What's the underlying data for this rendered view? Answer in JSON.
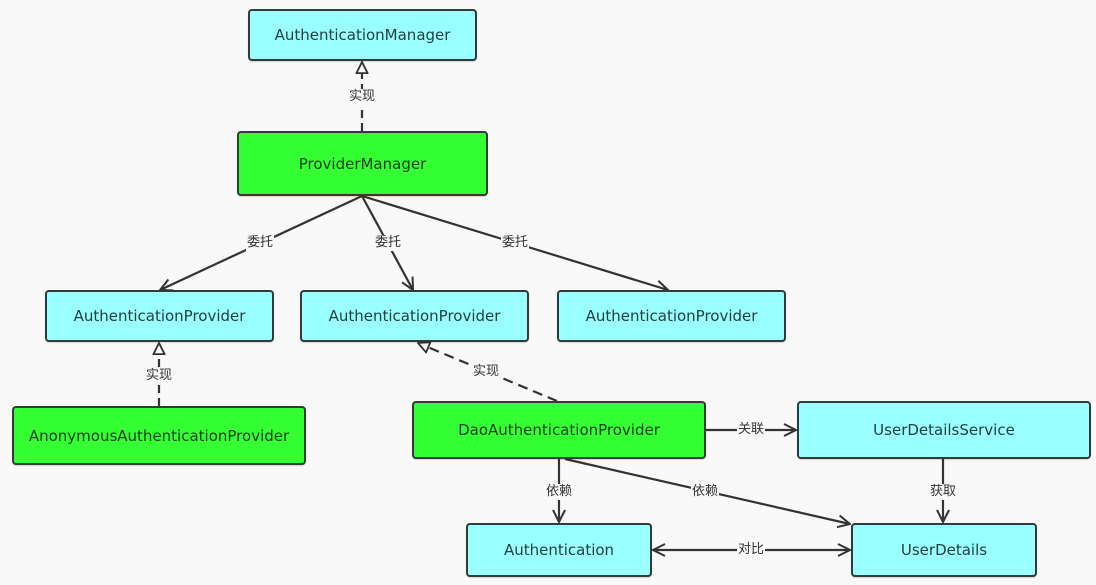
{
  "diagram": {
    "nodes": {
      "authentication_manager": {
        "label": "AuthenticationManager",
        "kind": "interface",
        "color": "#99ffff"
      },
      "provider_manager": {
        "label": "ProviderManager",
        "kind": "class",
        "color": "#33ff33"
      },
      "auth_provider_1": {
        "label": "AuthenticationProvider",
        "kind": "interface",
        "color": "#99ffff"
      },
      "auth_provider_2": {
        "label": "AuthenticationProvider",
        "kind": "interface",
        "color": "#99ffff"
      },
      "auth_provider_3": {
        "label": "AuthenticationProvider",
        "kind": "interface",
        "color": "#99ffff"
      },
      "anonymous_provider": {
        "label": "AnonymousAuthenticationProvider",
        "kind": "class",
        "color": "#33ff33"
      },
      "dao_provider": {
        "label": "DaoAuthenticationProvider",
        "kind": "class",
        "color": "#33ff33"
      },
      "user_details_service": {
        "label": "UserDetailsService",
        "kind": "interface",
        "color": "#99ffff"
      },
      "authentication": {
        "label": "Authentication",
        "kind": "interface",
        "color": "#99ffff"
      },
      "user_details": {
        "label": "UserDetails",
        "kind": "interface",
        "color": "#99ffff"
      }
    },
    "edges": [
      {
        "from": "provider_manager",
        "to": "authentication_manager",
        "label": "实现",
        "style": "dashed-realization"
      },
      {
        "from": "provider_manager",
        "to": "auth_provider_1",
        "label": "委托",
        "style": "solid-arrow"
      },
      {
        "from": "provider_manager",
        "to": "auth_provider_2",
        "label": "委托",
        "style": "solid-arrow"
      },
      {
        "from": "provider_manager",
        "to": "auth_provider_3",
        "label": "委托",
        "style": "solid-arrow"
      },
      {
        "from": "anonymous_provider",
        "to": "auth_provider_1",
        "label": "实现",
        "style": "dashed-realization"
      },
      {
        "from": "dao_provider",
        "to": "auth_provider_2",
        "label": "实现",
        "style": "dashed-realization"
      },
      {
        "from": "dao_provider",
        "to": "user_details_service",
        "label": "关联",
        "style": "solid-arrow"
      },
      {
        "from": "dao_provider",
        "to": "authentication",
        "label": "依赖",
        "style": "solid-arrow"
      },
      {
        "from": "dao_provider",
        "to": "user_details",
        "label": "依赖",
        "style": "solid-arrow"
      },
      {
        "from": "user_details_service",
        "to": "user_details",
        "label": "获取",
        "style": "solid-arrow"
      },
      {
        "from": "authentication",
        "to": "user_details",
        "label": "对比",
        "style": "bidirectional-arrow"
      }
    ]
  }
}
